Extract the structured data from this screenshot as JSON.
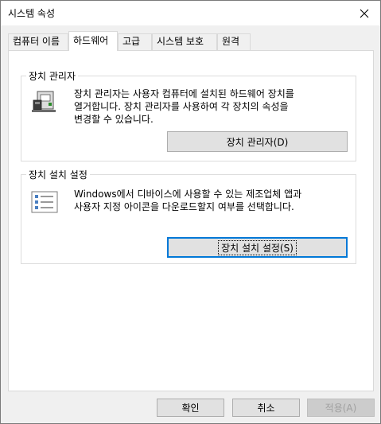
{
  "window": {
    "title": "시스템 속성"
  },
  "tabs": [
    {
      "label": "컴퓨터 이름",
      "active": false
    },
    {
      "label": "하드웨어",
      "active": true
    },
    {
      "label": "고급",
      "active": false
    },
    {
      "label": "시스템 보호",
      "active": false
    },
    {
      "label": "원격",
      "active": false
    }
  ],
  "device_manager": {
    "group_label": "장치 관리자",
    "description_line1": "장치 관리자는 사용자 컴퓨터에 설치된 하드웨어 장치를",
    "description_line2": "열거합니다. 장치 관리자를 사용하여 각 장치의 속성을",
    "description_line3": "변경할 수 있습니다.",
    "button_label": "장치 관리자(D)"
  },
  "device_install": {
    "group_label": "장치 설치 설정",
    "description_line1": "Windows에서 디바이스에 사용할 수 있는 제조업체 앱과",
    "description_line2": "사용자 지정 아이콘을 다운로드할지 여부를 선택합니다.",
    "button_label": "장치 설치 설정(S)"
  },
  "footer": {
    "ok_label": "확인",
    "cancel_label": "취소",
    "apply_label": "적용(A)"
  }
}
